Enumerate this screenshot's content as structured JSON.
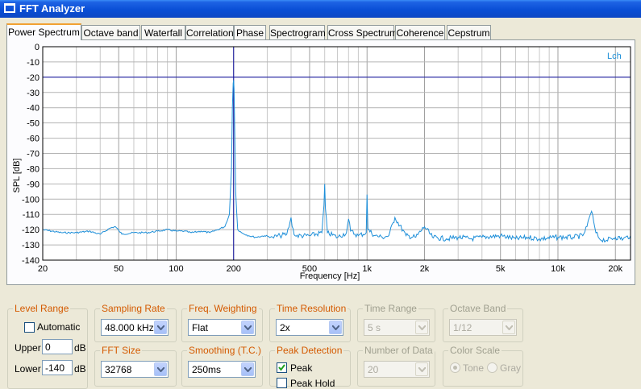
{
  "window": {
    "title": "FFT Analyzer"
  },
  "tabs": [
    {
      "label": "Power Spectrum",
      "active": true
    },
    {
      "label": "Octave band"
    },
    {
      "label": "Waterfall"
    },
    {
      "label": "Correlation"
    },
    {
      "label": "Phase"
    },
    {
      "label": "Spectrogram"
    },
    {
      "label": "Cross Spectrum"
    },
    {
      "label": "Coherence"
    },
    {
      "label": "Cepstrum"
    }
  ],
  "chart_data": {
    "type": "line",
    "xlabel": "Frequency [Hz]",
    "ylabel": "SPL [dB]",
    "x_scale": "log",
    "xlim": [
      20,
      24000
    ],
    "ylim": [
      -140,
      0
    ],
    "x_ticks": [
      {
        "v": 20,
        "label": "20"
      },
      {
        "v": 50,
        "label": "50"
      },
      {
        "v": 100,
        "label": "100"
      },
      {
        "v": 200,
        "label": "200"
      },
      {
        "v": 500,
        "label": "500"
      },
      {
        "v": 1000,
        "label": "1k"
      },
      {
        "v": 2000,
        "label": "2k"
      },
      {
        "v": 5000,
        "label": "5k"
      },
      {
        "v": 10000,
        "label": "10k"
      },
      {
        "v": 20000,
        "label": "20k"
      }
    ],
    "y_ticks": [
      0,
      -10,
      -20,
      -30,
      -40,
      -50,
      -60,
      -70,
      -80,
      -90,
      -100,
      -110,
      -120,
      -130,
      -140
    ],
    "grid": true,
    "cursor": {
      "x": 200,
      "y": -20
    },
    "series": [
      {
        "name": "Lch",
        "color": "#1e8fd9",
        "x": [
          20,
          25,
          30,
          35,
          40,
          45,
          48,
          52,
          60,
          70,
          80,
          90,
          100,
          110,
          120,
          135,
          150,
          165,
          180,
          190,
          195,
          197,
          199,
          200,
          201,
          203,
          205,
          210,
          220,
          240,
          260,
          290,
          320,
          350,
          380,
          395,
          400,
          405,
          420,
          500,
          580,
          595,
          600,
          605,
          620,
          700,
          780,
          800,
          820,
          900,
          990,
          1000,
          1010,
          1100,
          1200,
          1300,
          1400,
          1600,
          1800,
          2000,
          2200,
          2600,
          3000,
          3500,
          4000,
          5000,
          6000,
          7000,
          8000,
          10000,
          12000,
          13500,
          14200,
          14600,
          15000,
          15400,
          15800,
          16500,
          18000,
          20000,
          22000,
          24000
        ],
        "y": [
          -120,
          -122,
          -122,
          -121,
          -123,
          -119,
          -118,
          -123,
          -122,
          -122,
          -121,
          -120,
          -121,
          -121,
          -122,
          -121,
          -122,
          -120,
          -118,
          -110,
          -80,
          -40,
          -24,
          -22,
          -28,
          -60,
          -95,
          -120,
          -122,
          -124,
          -125,
          -124,
          -125,
          -124,
          -123,
          -115,
          -112,
          -118,
          -124,
          -124,
          -122,
          -104,
          -90,
          -106,
          -122,
          -125,
          -122,
          -113,
          -121,
          -124,
          -122,
          -97,
          -120,
          -124,
          -125,
          -124,
          -112,
          -124,
          -125,
          -118,
          -125,
          -126,
          -125,
          -126,
          -125,
          -124,
          -126,
          -125,
          -126,
          -125,
          -125,
          -124,
          -118,
          -112,
          -108,
          -115,
          -122,
          -126,
          -127,
          -125,
          -126,
          -124
        ]
      }
    ]
  },
  "controls": {
    "level_range": {
      "title": "Level Range",
      "automatic_label": "Automatic",
      "automatic_checked": false,
      "upper_label": "Upper",
      "upper_value": "0",
      "upper_unit": "dB",
      "lower_label": "Lower",
      "lower_value": "-140",
      "lower_unit": "dB"
    },
    "sampling_rate": {
      "title": "Sampling Rate",
      "value": "48.000 kHz"
    },
    "fft_size": {
      "title": "FFT Size",
      "value": "32768"
    },
    "freq_weighting": {
      "title": "Freq. Weighting",
      "value": "Flat"
    },
    "smoothing": {
      "title": "Smoothing (T.C.)",
      "value": "250ms"
    },
    "time_resolution": {
      "title": "Time Resolution",
      "value": "2x"
    },
    "peak_detection": {
      "title": "Peak Detection",
      "peak_label": "Peak",
      "peak_checked": true,
      "peak_hold_label": "Peak Hold",
      "peak_hold_checked": false
    },
    "time_range": {
      "title": "Time Range",
      "value": "5 s"
    },
    "number_of_data": {
      "title": "Number of Data",
      "value": "20"
    },
    "octave_band": {
      "title": "Octave Band",
      "value": "1/12"
    },
    "color_scale": {
      "title": "Color Scale",
      "tone_label": "Tone",
      "gray_label": "Gray"
    }
  }
}
